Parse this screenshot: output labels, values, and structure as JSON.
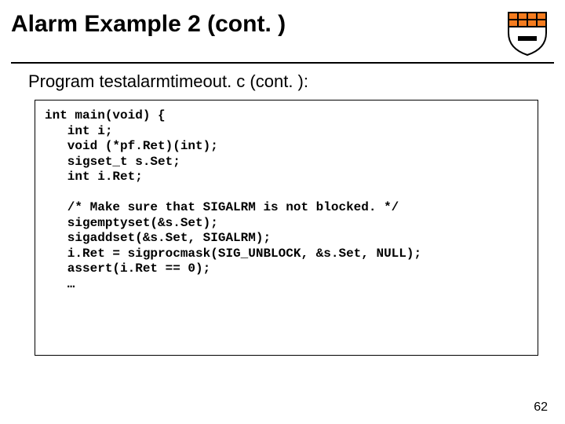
{
  "title": "Alarm Example 2 (cont. )",
  "subtitle": "Program testalarmtimeout. c (cont. ):",
  "code": {
    "l1": "int main(void) {",
    "l2": "   int i;",
    "l3": "   void (*pf.Ret)(int);",
    "l4": "   sigset_t s.Set;",
    "l5": "   int i.Ret;",
    "l6": "",
    "l7": "   /* Make sure that SIGALRM is not blocked. */",
    "l8": "   sigemptyset(&s.Set);",
    "l9": "   sigaddset(&s.Set, SIGALRM);",
    "l10": "   i.Ret = sigprocmask(SIG_UNBLOCK, &s.Set, NULL);",
    "l11": "   assert(i.Ret == 0);",
    "l12": "   …"
  },
  "page_number": "62"
}
